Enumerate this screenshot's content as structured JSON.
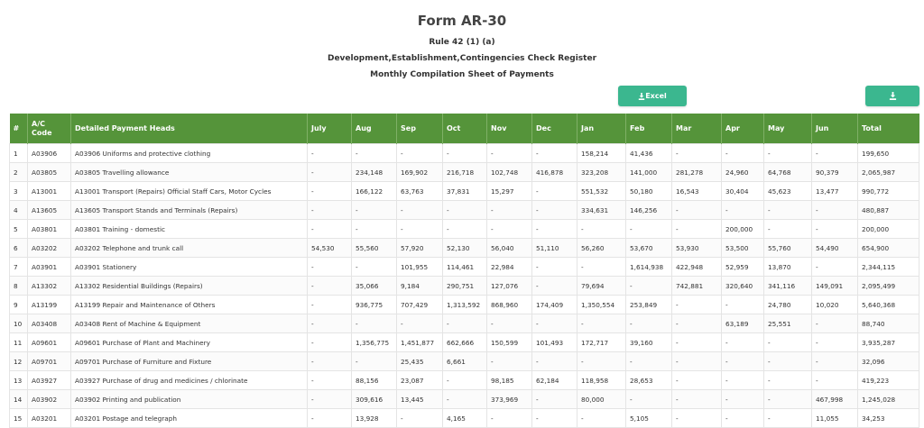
{
  "header": {
    "title": "Form AR-30",
    "rule": "Rule 42 (1) (a)",
    "register": "Development,Establishment,Contingencies Check Register",
    "sheet": "Monthly Compilation Sheet of Payments"
  },
  "buttons": {
    "excel_label": "Excel",
    "excel_icon": "download-icon",
    "download_icon": "download-icon"
  },
  "colors": {
    "header_bg": "#55943a",
    "button_bg": "#3bb78f"
  },
  "table": {
    "columns": [
      "#",
      "A/C Code",
      "Detailed Payment Heads",
      "July",
      "Aug",
      "Sep",
      "Oct",
      "Nov",
      "Dec",
      "Jan",
      "Feb",
      "Mar",
      "Apr",
      "May",
      "Jun",
      "Total"
    ],
    "rows": [
      [
        "1",
        "A03906",
        "A03906 Uniforms and protective clothing",
        "-",
        "-",
        "-",
        "-",
        "-",
        "-",
        "158,214",
        "41,436",
        "-",
        "-",
        "-",
        "-",
        "199,650"
      ],
      [
        "2",
        "A03805",
        "A03805 Travelling allowance",
        "-",
        "234,148",
        "169,902",
        "216,718",
        "102,748",
        "416,878",
        "323,208",
        "141,000",
        "281,278",
        "24,960",
        "64,768",
        "90,379",
        "2,065,987"
      ],
      [
        "3",
        "A13001",
        "A13001 Transport (Repairs) Official Staff Cars, Motor Cycles",
        "-",
        "166,122",
        "63,763",
        "37,831",
        "15,297",
        "-",
        "551,532",
        "50,180",
        "16,543",
        "30,404",
        "45,623",
        "13,477",
        "990,772"
      ],
      [
        "4",
        "A13605",
        "A13605 Transport Stands and Terminals (Repairs)",
        "-",
        "-",
        "-",
        "-",
        "-",
        "-",
        "334,631",
        "146,256",
        "-",
        "-",
        "-",
        "-",
        "480,887"
      ],
      [
        "5",
        "A03801",
        "A03801 Training - domestic",
        "-",
        "-",
        "-",
        "-",
        "-",
        "-",
        "-",
        "-",
        "-",
        "200,000",
        "-",
        "-",
        "200,000"
      ],
      [
        "6",
        "A03202",
        "A03202 Telephone and trunk call",
        "54,530",
        "55,560",
        "57,920",
        "52,130",
        "56,040",
        "51,110",
        "56,260",
        "53,670",
        "53,930",
        "53,500",
        "55,760",
        "54,490",
        "654,900"
      ],
      [
        "7",
        "A03901",
        "A03901 Stationery",
        "-",
        "-",
        "101,955",
        "114,461",
        "22,984",
        "-",
        "-",
        "1,614,938",
        "422,948",
        "52,959",
        "13,870",
        "-",
        "2,344,115"
      ],
      [
        "8",
        "A13302",
        "A13302 Residential Buildings (Repairs)",
        "-",
        "35,066",
        "9,184",
        "290,751",
        "127,076",
        "-",
        "79,694",
        "-",
        "742,881",
        "320,640",
        "341,116",
        "149,091",
        "2,095,499"
      ],
      [
        "9",
        "A13199",
        "A13199 Repair and Maintenance of Others",
        "-",
        "936,775",
        "707,429",
        "1,313,592",
        "868,960",
        "174,409",
        "1,350,554",
        "253,849",
        "-",
        "-",
        "24,780",
        "10,020",
        "5,640,368"
      ],
      [
        "10",
        "A03408",
        "A03408 Rent of Machine & Equipment",
        "-",
        "-",
        "-",
        "-",
        "-",
        "-",
        "-",
        "-",
        "-",
        "63,189",
        "25,551",
        "-",
        "88,740"
      ],
      [
        "11",
        "A09601",
        "A09601 Purchase of Plant and Machinery",
        "-",
        "1,356,775",
        "1,451,877",
        "662,666",
        "150,599",
        "101,493",
        "172,717",
        "39,160",
        "-",
        "-",
        "-",
        "-",
        "3,935,287"
      ],
      [
        "12",
        "A09701",
        "A09701 Purchase of Furniture and Fixture",
        "-",
        "-",
        "25,435",
        "6,661",
        "-",
        "-",
        "-",
        "-",
        "-",
        "-",
        "-",
        "-",
        "32,096"
      ],
      [
        "13",
        "A03927",
        "A03927 Purchase of drug and medicines / chlorinate",
        "-",
        "88,156",
        "23,087",
        "-",
        "98,185",
        "62,184",
        "118,958",
        "28,653",
        "-",
        "-",
        "-",
        "-",
        "419,223"
      ],
      [
        "14",
        "A03902",
        "A03902 Printing and publication",
        "-",
        "309,616",
        "13,445",
        "-",
        "373,969",
        "-",
        "80,000",
        "-",
        "-",
        "-",
        "-",
        "467,998",
        "1,245,028"
      ],
      [
        "15",
        "A03201",
        "A03201 Postage and telegraph",
        "-",
        "13,928",
        "-",
        "4,165",
        "-",
        "-",
        "-",
        "5,105",
        "-",
        "-",
        "-",
        "11,055",
        "34,253"
      ]
    ]
  }
}
